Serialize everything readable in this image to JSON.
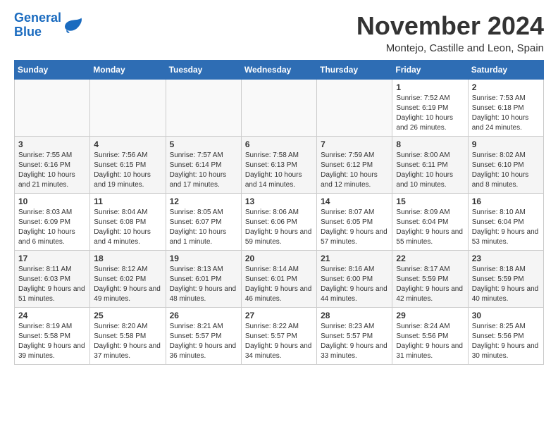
{
  "logo": {
    "text_general": "General",
    "text_blue": "Blue"
  },
  "header": {
    "title": "November 2024",
    "subtitle": "Montejo, Castille and Leon, Spain"
  },
  "weekdays": [
    "Sunday",
    "Monday",
    "Tuesday",
    "Wednesday",
    "Thursday",
    "Friday",
    "Saturday"
  ],
  "weeks": [
    [
      {
        "day": "",
        "info": ""
      },
      {
        "day": "",
        "info": ""
      },
      {
        "day": "",
        "info": ""
      },
      {
        "day": "",
        "info": ""
      },
      {
        "day": "",
        "info": ""
      },
      {
        "day": "1",
        "info": "Sunrise: 7:52 AM\nSunset: 6:19 PM\nDaylight: 10 hours and 26 minutes."
      },
      {
        "day": "2",
        "info": "Sunrise: 7:53 AM\nSunset: 6:18 PM\nDaylight: 10 hours and 24 minutes."
      }
    ],
    [
      {
        "day": "3",
        "info": "Sunrise: 7:55 AM\nSunset: 6:16 PM\nDaylight: 10 hours and 21 minutes."
      },
      {
        "day": "4",
        "info": "Sunrise: 7:56 AM\nSunset: 6:15 PM\nDaylight: 10 hours and 19 minutes."
      },
      {
        "day": "5",
        "info": "Sunrise: 7:57 AM\nSunset: 6:14 PM\nDaylight: 10 hours and 17 minutes."
      },
      {
        "day": "6",
        "info": "Sunrise: 7:58 AM\nSunset: 6:13 PM\nDaylight: 10 hours and 14 minutes."
      },
      {
        "day": "7",
        "info": "Sunrise: 7:59 AM\nSunset: 6:12 PM\nDaylight: 10 hours and 12 minutes."
      },
      {
        "day": "8",
        "info": "Sunrise: 8:00 AM\nSunset: 6:11 PM\nDaylight: 10 hours and 10 minutes."
      },
      {
        "day": "9",
        "info": "Sunrise: 8:02 AM\nSunset: 6:10 PM\nDaylight: 10 hours and 8 minutes."
      }
    ],
    [
      {
        "day": "10",
        "info": "Sunrise: 8:03 AM\nSunset: 6:09 PM\nDaylight: 10 hours and 6 minutes."
      },
      {
        "day": "11",
        "info": "Sunrise: 8:04 AM\nSunset: 6:08 PM\nDaylight: 10 hours and 4 minutes."
      },
      {
        "day": "12",
        "info": "Sunrise: 8:05 AM\nSunset: 6:07 PM\nDaylight: 10 hours and 1 minute."
      },
      {
        "day": "13",
        "info": "Sunrise: 8:06 AM\nSunset: 6:06 PM\nDaylight: 9 hours and 59 minutes."
      },
      {
        "day": "14",
        "info": "Sunrise: 8:07 AM\nSunset: 6:05 PM\nDaylight: 9 hours and 57 minutes."
      },
      {
        "day": "15",
        "info": "Sunrise: 8:09 AM\nSunset: 6:04 PM\nDaylight: 9 hours and 55 minutes."
      },
      {
        "day": "16",
        "info": "Sunrise: 8:10 AM\nSunset: 6:04 PM\nDaylight: 9 hours and 53 minutes."
      }
    ],
    [
      {
        "day": "17",
        "info": "Sunrise: 8:11 AM\nSunset: 6:03 PM\nDaylight: 9 hours and 51 minutes."
      },
      {
        "day": "18",
        "info": "Sunrise: 8:12 AM\nSunset: 6:02 PM\nDaylight: 9 hours and 49 minutes."
      },
      {
        "day": "19",
        "info": "Sunrise: 8:13 AM\nSunset: 6:01 PM\nDaylight: 9 hours and 48 minutes."
      },
      {
        "day": "20",
        "info": "Sunrise: 8:14 AM\nSunset: 6:01 PM\nDaylight: 9 hours and 46 minutes."
      },
      {
        "day": "21",
        "info": "Sunrise: 8:16 AM\nSunset: 6:00 PM\nDaylight: 9 hours and 44 minutes."
      },
      {
        "day": "22",
        "info": "Sunrise: 8:17 AM\nSunset: 5:59 PM\nDaylight: 9 hours and 42 minutes."
      },
      {
        "day": "23",
        "info": "Sunrise: 8:18 AM\nSunset: 5:59 PM\nDaylight: 9 hours and 40 minutes."
      }
    ],
    [
      {
        "day": "24",
        "info": "Sunrise: 8:19 AM\nSunset: 5:58 PM\nDaylight: 9 hours and 39 minutes."
      },
      {
        "day": "25",
        "info": "Sunrise: 8:20 AM\nSunset: 5:58 PM\nDaylight: 9 hours and 37 minutes."
      },
      {
        "day": "26",
        "info": "Sunrise: 8:21 AM\nSunset: 5:57 PM\nDaylight: 9 hours and 36 minutes."
      },
      {
        "day": "27",
        "info": "Sunrise: 8:22 AM\nSunset: 5:57 PM\nDaylight: 9 hours and 34 minutes."
      },
      {
        "day": "28",
        "info": "Sunrise: 8:23 AM\nSunset: 5:57 PM\nDaylight: 9 hours and 33 minutes."
      },
      {
        "day": "29",
        "info": "Sunrise: 8:24 AM\nSunset: 5:56 PM\nDaylight: 9 hours and 31 minutes."
      },
      {
        "day": "30",
        "info": "Sunrise: 8:25 AM\nSunset: 5:56 PM\nDaylight: 9 hours and 30 minutes."
      }
    ]
  ]
}
